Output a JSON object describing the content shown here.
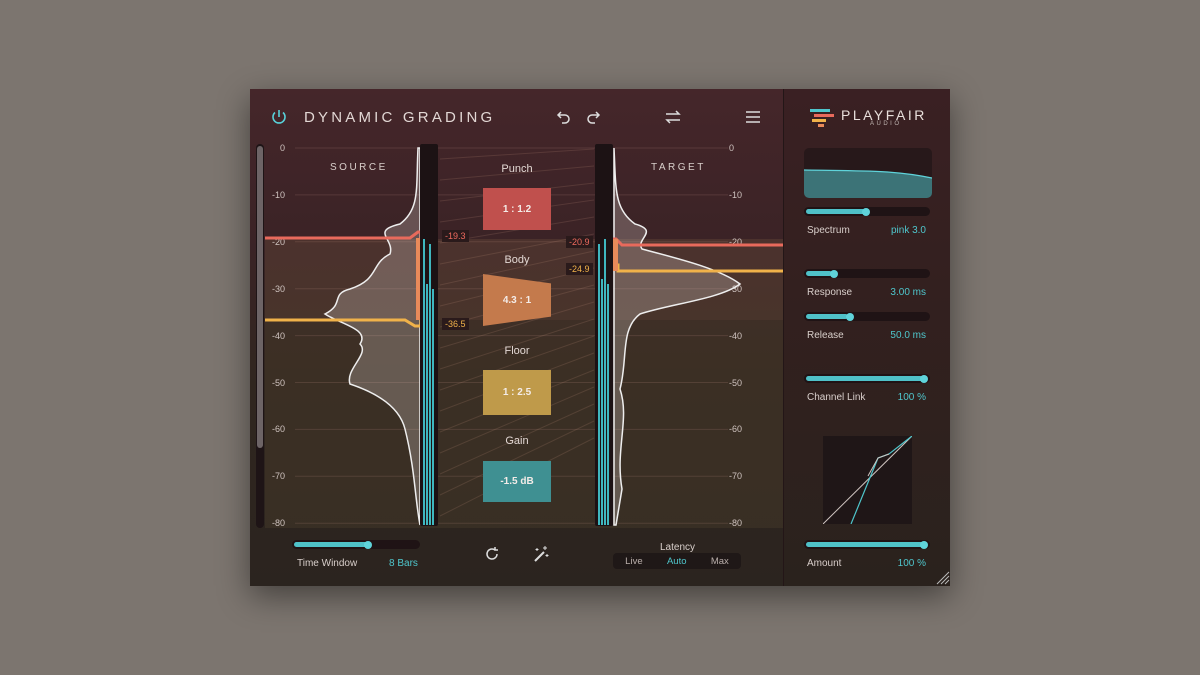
{
  "header": {
    "title": "DYNAMIC GRADING",
    "power_icon": "power-icon",
    "undo_icon": "undo-icon",
    "redo_icon": "redo-icon",
    "swap_icon": "swap-icon",
    "menu_icon": "menu-icon"
  },
  "brand": {
    "name": "PLAYFAIR",
    "sub": "AUDIO"
  },
  "scale": {
    "ticks": [
      "0",
      "-10",
      "-20",
      "-30",
      "-40",
      "-50",
      "-60",
      "-70",
      "-80"
    ]
  },
  "source": {
    "label": "SOURCE",
    "punch_threshold": "-19.3",
    "floor_threshold": "-36.5"
  },
  "target": {
    "label": "TARGET",
    "punch_threshold": "-20.9",
    "floor_threshold": "-24.9"
  },
  "bands": [
    {
      "name": "Punch",
      "value": "1 : 1.2",
      "color": "#c0504d"
    },
    {
      "name": "Body",
      "value": "4.3 : 1",
      "color": "#c47a4c"
    },
    {
      "name": "Floor",
      "value": "1 : 2.5",
      "color": "#bf9a4a"
    },
    {
      "name": "Gain",
      "value": "-1.5 dB",
      "color": "#3f9092"
    }
  ],
  "bottom": {
    "time_window_label": "Time Window",
    "time_window_value": "8 Bars",
    "time_window_level": 0.6,
    "reset_icon": "reset-icon",
    "magic_icon": "magic-wand-icon",
    "latency_label": "Latency",
    "latency_options": [
      "Live",
      "Auto",
      "Max"
    ],
    "latency_selected": "Auto"
  },
  "sidebar": {
    "spectrum": {
      "label": "Spectrum",
      "value": "pink 3.0",
      "level": 0.5
    },
    "response": {
      "label": "Response",
      "value": "3.00 ms",
      "level": 0.22
    },
    "release": {
      "label": "Release",
      "value": "50.0 ms",
      "level": 0.36
    },
    "channel_link": {
      "label": "Channel Link",
      "value": "100 %",
      "level": 1.0
    },
    "amount": {
      "label": "Amount",
      "value": "100 %",
      "level": 1.0
    }
  },
  "colors": {
    "accent": "#4fc6cc",
    "punch": "#e86a5c",
    "floor": "#f0b24a"
  }
}
